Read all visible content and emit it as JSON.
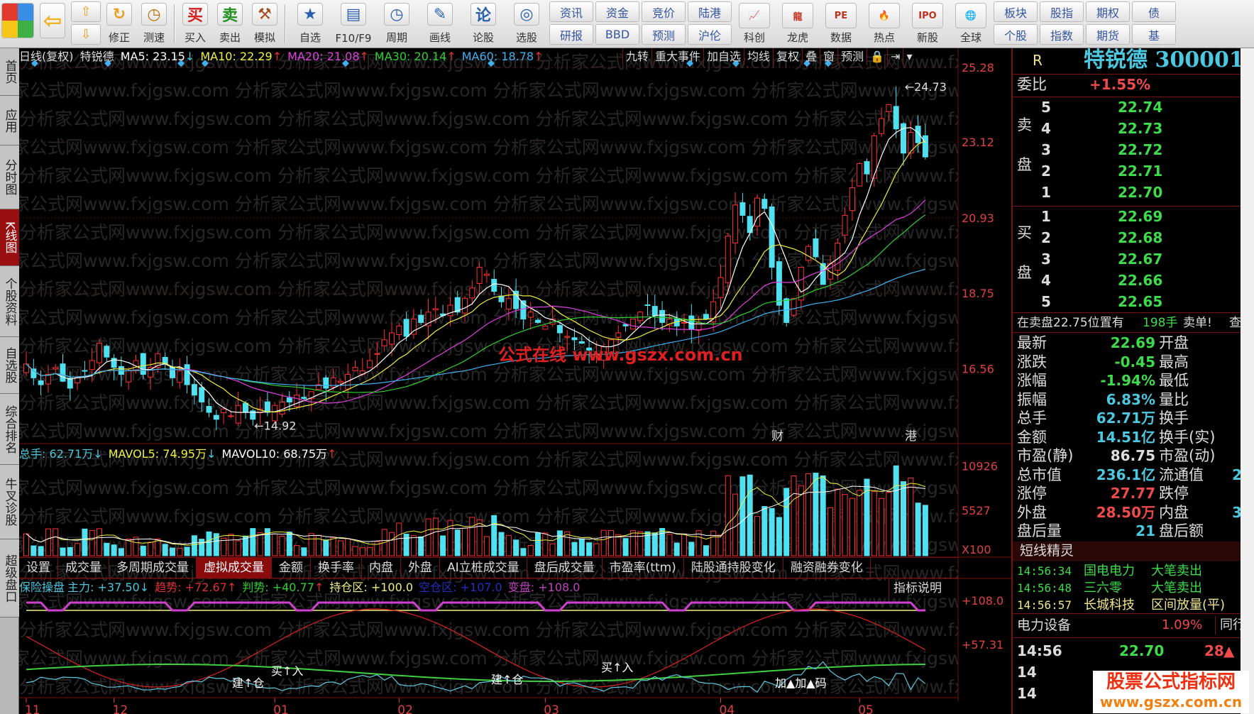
{
  "toolbar": {
    "left": [
      {
        "label": "修正",
        "icon": "refresh-icon"
      },
      {
        "label": "测速",
        "icon": "clock-icon"
      }
    ],
    "trade": [
      {
        "label": "买入",
        "glyph": "买",
        "color": "#d02020"
      },
      {
        "label": "卖出",
        "glyph": "卖",
        "color": "#209020"
      },
      {
        "label": "模拟",
        "glyph": "⚒",
        "color": "#a05020"
      }
    ],
    "tools": [
      {
        "label": "自选",
        "glyph": "★"
      },
      {
        "label": "F10/F9",
        "glyph": "▤"
      },
      {
        "label": "周期",
        "glyph": "◷"
      },
      {
        "label": "画线",
        "glyph": "✎"
      },
      {
        "label": "论股",
        "glyph": "论"
      },
      {
        "label": "选股",
        "glyph": "◎"
      }
    ],
    "grid1": [
      [
        "资讯",
        "研报"
      ],
      [
        "资金",
        "BBD"
      ],
      [
        "竞价",
        "预测"
      ],
      [
        "陆港",
        "沪伦"
      ]
    ],
    "apps": [
      {
        "label": "科创",
        "glyph": "📈"
      },
      {
        "label": "龙虎",
        "glyph": "龍"
      },
      {
        "label": "数据",
        "glyph": "PE"
      },
      {
        "label": "热点",
        "glyph": "🔥"
      },
      {
        "label": "新股",
        "glyph": "IPO"
      },
      {
        "label": "全球",
        "glyph": "🌐"
      }
    ],
    "grid2": [
      [
        "板块",
        "个股"
      ],
      [
        "股指",
        "指数"
      ],
      [
        "期权",
        "期货"
      ],
      [
        "债",
        "基"
      ]
    ]
  },
  "sidebar": [
    "首页",
    "应用",
    "分时图",
    "K线图",
    "个股资料",
    "自选股",
    "综合排名",
    "牛叉诊股",
    "超级盘口"
  ],
  "main": {
    "title": "日线(复权)",
    "stock": "特锐德",
    "ma": [
      {
        "k": "MA5: 23.15",
        "arrow": "↓",
        "color": "#ffffff"
      },
      {
        "k": "MA10: 22.29",
        "arrow": "↑",
        "color": "#f0f040"
      },
      {
        "k": "MA20: 21.08",
        "arrow": "↑",
        "color": "#e040e0"
      },
      {
        "k": "MA30: 20.14",
        "arrow": "↑",
        "color": "#30d030"
      },
      {
        "k": "MA60: 18.78",
        "arrow": "↑",
        "color": "#40b0f0"
      }
    ],
    "buttons": [
      "九转",
      "重大事件",
      "加自选",
      "均线",
      "复权",
      "叠",
      "窗",
      "预测"
    ],
    "price_ticks": [
      "25.28",
      "23.12",
      "20.93",
      "18.75",
      "16.56"
    ],
    "high_label": "24.73",
    "low_label": "14.92",
    "event_marks": [
      "财",
      "港"
    ],
    "watermark": "分析家公式网www.fxjgsw.com",
    "center_watermark": "公式在线 www.gszx.com.cn"
  },
  "volume": {
    "items": [
      {
        "k": "总手: 62.71万",
        "arrow": "↓",
        "color": "#4cc8e0"
      },
      {
        "k": "MAVOL5: 74.95万",
        "arrow": "↓",
        "color": "#f0f040"
      },
      {
        "k": "MAVOL10: 68.75万",
        "arrow": "↑",
        "color": "#ffffff"
      }
    ],
    "ticks": [
      "10926",
      "5527",
      "X100"
    ]
  },
  "tabs": [
    "设置",
    "成交量",
    "多周期成交量",
    "虚拟成交量",
    "金额",
    "换手率",
    "内盘",
    "外盘",
    "AI立桩成交量",
    "盘后成交量",
    "市盈率(ttm)",
    "陆股通持股变化",
    "融资融券变化"
  ],
  "active_tab": 3,
  "indicator": {
    "name": "保险操盘",
    "items": [
      {
        "k": "主力: +37.50",
        "arrow": "↓",
        "color": "#4cc8e0"
      },
      {
        "k": "趋势: +72.67",
        "arrow": "↑",
        "color": "#e03030"
      },
      {
        "k": "判势: +40.77",
        "arrow": "↑",
        "color": "#30d030"
      },
      {
        "k": "持仓区: +100.0",
        "arrow": "",
        "color": "#f0f080"
      },
      {
        "k": "空仓区: +107.0",
        "arrow": "",
        "color": "#2030c0"
      },
      {
        "k": "变盘: +108.0",
        "arrow": "",
        "color": "#c040c0"
      }
    ],
    "help": "指标说明",
    "ticks": [
      "+108.0",
      "+57.31"
    ],
    "signals": [
      "建↑仓",
      "买↑入",
      "建↑仓",
      "买↑入",
      "加▲加▲码"
    ]
  },
  "months": [
    {
      "label": "11",
      "index": 0
    },
    {
      "label": "12",
      "index": 12
    },
    {
      "label": "01",
      "index": 34
    },
    {
      "label": "02",
      "index": 51
    },
    {
      "label": "03",
      "index": 71
    },
    {
      "label": "04",
      "index": 95
    },
    {
      "label": "05",
      "index": 114
    }
  ],
  "closes": [
    16.7,
    16.3,
    16.1,
    16.4,
    16.6,
    16.2,
    16.0,
    16.3,
    16.5,
    16.8,
    17.3,
    16.9,
    16.6,
    16.4,
    16.5,
    16.8,
    16.4,
    16.6,
    17.0,
    16.7,
    16.3,
    16.5,
    16.1,
    15.8,
    15.6,
    15.3,
    15.1,
    15.4,
    15.2,
    15.5,
    15.3,
    15.1,
    15.4,
    15.3,
    15.5,
    15.6,
    15.6,
    15.8,
    15.7,
    15.9,
    16.1,
    16.0,
    16.3,
    16.2,
    16.4,
    16.6,
    16.5,
    16.8,
    17.0,
    17.4,
    17.6,
    17.8,
    17.5,
    18.0,
    17.9,
    18.2,
    18.3,
    18.1,
    18.4,
    18.2,
    18.6,
    18.9,
    19.5,
    19.3,
    18.8,
    18.5,
    18.6,
    18.3,
    18.0,
    18.2,
    17.9,
    17.8,
    18.0,
    17.6,
    17.5,
    17.4,
    17.3,
    17.1,
    17.0,
    17.2,
    17.4,
    17.6,
    17.8,
    18.0,
    18.2,
    18.4,
    18.1,
    17.9,
    18.0,
    17.8,
    17.9,
    17.7,
    17.9,
    18.0,
    18.5,
    19.2,
    20.4,
    21.3,
    21.0,
    20.5,
    21.5,
    21.2,
    19.5,
    18.4,
    17.9,
    18.6,
    19.5,
    20.1,
    19.8,
    19.0,
    19.6,
    20.2,
    21.0,
    21.8,
    22.5,
    22.2,
    23.3,
    23.8,
    24.2,
    23.5,
    22.8,
    23.4,
    23.1,
    22.69
  ],
  "quote": {
    "flag": "R",
    "title": "特锐德 300001",
    "weibi_label": "委比",
    "weibi": "+1.55%",
    "sell_label": "卖盘",
    "buy_label": "买盘",
    "sell": [
      {
        "n": "5",
        "p": "22.74"
      },
      {
        "n": "4",
        "p": "22.73"
      },
      {
        "n": "3",
        "p": "22.72"
      },
      {
        "n": "2",
        "p": "22.71"
      },
      {
        "n": "1",
        "p": "22.70"
      }
    ],
    "buy": [
      {
        "n": "1",
        "p": "22.69"
      },
      {
        "n": "2",
        "p": "22.68"
      },
      {
        "n": "3",
        "p": "22.67"
      },
      {
        "n": "4",
        "p": "22.66"
      },
      {
        "n": "5",
        "p": "22.65"
      }
    ],
    "notice": {
      "text": "在卖盘22.75位置有",
      "qty": "198手",
      "tag": "卖单!",
      "more": "查"
    },
    "stats": [
      {
        "l": "最新",
        "v": "22.69",
        "c": "g",
        "r": "开盘",
        "rv": ""
      },
      {
        "l": "涨跌",
        "v": "-0.45",
        "c": "g",
        "r": "最高",
        "rv": ""
      },
      {
        "l": "涨幅",
        "v": "-1.94%",
        "c": "g",
        "r": "最低",
        "rv": ""
      },
      {
        "l": "振幅",
        "v": "6.83%",
        "c": "c",
        "r": "量比",
        "rv": ""
      },
      {
        "l": "总手",
        "v": "62.71万",
        "c": "c",
        "r": "换手",
        "rv": ""
      },
      {
        "l": "金额",
        "v": "14.51亿",
        "c": "c",
        "r": "换手(实)",
        "rv": ""
      },
      {
        "l": "市盈(静)",
        "v": "86.75",
        "c": "w",
        "r": "市盈(动)",
        "rv": ""
      },
      {
        "l": "总市值",
        "v": "236.1亿",
        "c": "c",
        "r": "流通值",
        "rv": "2"
      },
      {
        "l": "涨停",
        "v": "27.77",
        "c": "r",
        "r": "跌停",
        "rv": ""
      },
      {
        "l": "外盘",
        "v": "28.50万",
        "c": "r",
        "r": "内盘",
        "rv": "3"
      },
      {
        "l": "盘后量",
        "v": "21",
        "c": "c",
        "r": "盘后额",
        "rv": ""
      }
    ],
    "sprite_title": "短线精灵",
    "sprites": [
      {
        "t": "14:56:34",
        "s": "国电电力",
        "e": "大笔卖出",
        "c": "g"
      },
      {
        "t": "14:56:48",
        "s": "三六零",
        "e": "大笔卖出",
        "c": "g"
      },
      {
        "t": "14:56:57",
        "s": "长城科技",
        "e": "区间放量(平)",
        "c": "y"
      }
    ],
    "industry": {
      "name": "电力设备",
      "pct": "1.09%",
      "peer": "同行"
    },
    "ticks": [
      {
        "t": "14:56",
        "p": "22.70",
        "v": "28"
      },
      {
        "t": "14",
        "p": "",
        "v": ""
      },
      {
        "t": "14",
        "p": "",
        "v": ""
      }
    ]
  },
  "logo": {
    "title": "股票公式指标网",
    "url": "www.gszx.com.cn"
  }
}
